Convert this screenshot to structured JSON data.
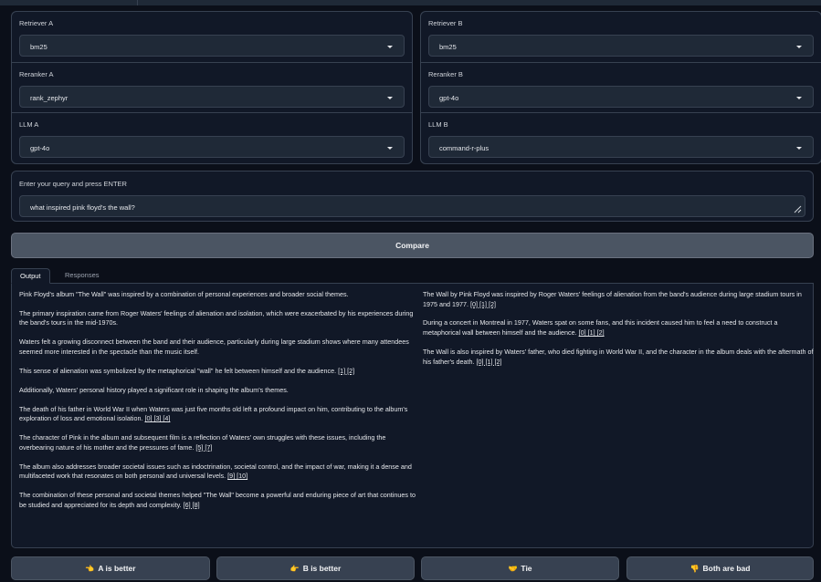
{
  "retriever_a": {
    "label": "Retriever A",
    "value": "bm25"
  },
  "reranker_a": {
    "label": "Reranker A",
    "value": "rank_zephyr"
  },
  "llm_a": {
    "label": "LLM A",
    "value": "gpt-4o"
  },
  "retriever_b": {
    "label": "Retriever B",
    "value": "bm25"
  },
  "reranker_b": {
    "label": "Reranker B",
    "value": "gpt-4o"
  },
  "llm_b": {
    "label": "LLM B",
    "value": "command-r-plus"
  },
  "query": {
    "label": "Enter your query and press ENTER",
    "value": "what inspired pink floyd's the wall?"
  },
  "compare_label": "Compare",
  "tabs": [
    {
      "label": "Output",
      "active": true
    },
    {
      "label": "Responses",
      "active": false
    }
  ],
  "output_a": [
    {
      "text": "Pink Floyd's album \"The Wall\" was inspired by a combination of personal experiences and broader social themes.",
      "cites": ""
    },
    {
      "text": "The primary inspiration came from Roger Waters' feelings of alienation and isolation, which were exacerbated by his experiences during the band's tours in the mid-1970s.",
      "cites": ""
    },
    {
      "text": "Waters felt a growing disconnect between the band and their audience, particularly during large stadium shows where many attendees seemed more interested in the spectacle than the music itself.",
      "cites": ""
    },
    {
      "text": "This sense of alienation was symbolized by the metaphorical \"wall\" he felt between himself and the audience.",
      "cites": "[1] [2]"
    },
    {
      "text": "Additionally, Waters' personal history played a significant role in shaping the album's themes.",
      "cites": ""
    },
    {
      "text": "The death of his father in World War II when Waters was just five months old left a profound impact on him, contributing to the album's exploration of loss and emotional isolation.",
      "cites": "[0] [3] [4]"
    },
    {
      "text": "The character of Pink in the album and subsequent film is a reflection of Waters' own struggles with these issues, including the overbearing nature of his mother and the pressures of fame.",
      "cites": "[5] [7]"
    },
    {
      "text": "The album also addresses broader societal issues such as indoctrination, societal control, and the impact of war, making it a dense and multifaceted work that resonates on both personal and universal levels.",
      "cites": "[9] [10]"
    },
    {
      "text": "The combination of these personal and societal themes helped \"The Wall\" become a powerful and enduring piece of art that continues to be studied and appreciated for its depth and complexity.",
      "cites": "[6] [8]"
    }
  ],
  "output_b": [
    {
      "text": "The Wall by Pink Floyd was inspired by Roger Waters' feelings of alienation from the band's audience during large stadium tours in 1975 and 1977.",
      "cites": "[0] [1] [2]"
    },
    {
      "text": "During a concert in Montreal in 1977, Waters spat on some fans, and this incident caused him to feel a need to construct a metaphorical wall between himself and the audience.",
      "cites": "[0] [1] [2]"
    },
    {
      "text": "The Wall is also inspired by Waters' father, who died fighting in World War II, and the character in the album deals with the aftermath of his father's death.",
      "cites": "[0] [1] [2]"
    }
  ],
  "votes": [
    {
      "emoji": "👈",
      "label": "A is better"
    },
    {
      "emoji": "👉",
      "label": "B is better"
    },
    {
      "emoji": "🤝",
      "label": "Tie"
    },
    {
      "emoji": "👎",
      "label": "Both are bad"
    }
  ]
}
